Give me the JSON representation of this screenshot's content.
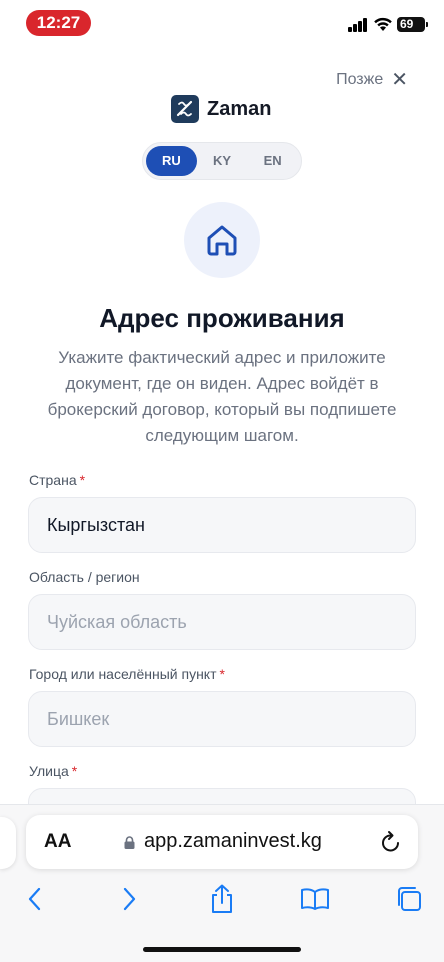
{
  "status_bar": {
    "time": "12:27",
    "battery": "69"
  },
  "header": {
    "later_label": "Позже",
    "close_icon": "close-icon"
  },
  "logo": {
    "name": "Zaman"
  },
  "languages": [
    {
      "code": "RU",
      "active": true
    },
    {
      "code": "KY",
      "active": false
    },
    {
      "code": "EN",
      "active": false
    }
  ],
  "page": {
    "title": "Адрес проживания",
    "subtitle": "Укажите фактический адрес и приложите документ, где он виден. Адрес войдёт в брокерский договор, который вы подпишете следующим шагом."
  },
  "form": {
    "country": {
      "label": "Страна",
      "required": "*",
      "value": "Кыргызстан"
    },
    "region": {
      "label": "Область / регион",
      "placeholder": "Чуйская область"
    },
    "city": {
      "label": "Город или населённый пункт",
      "required": "*",
      "placeholder": "Бишкек"
    },
    "street": {
      "label": "Улица",
      "required": "*"
    }
  },
  "browser": {
    "text_size_label": "AA",
    "url": "app.zamaninvest.kg"
  },
  "colors": {
    "accent": "#1e4fb5",
    "required": "#d9262c",
    "time_pill": "#d9262c",
    "ios_blue": "#1a7cf5"
  }
}
